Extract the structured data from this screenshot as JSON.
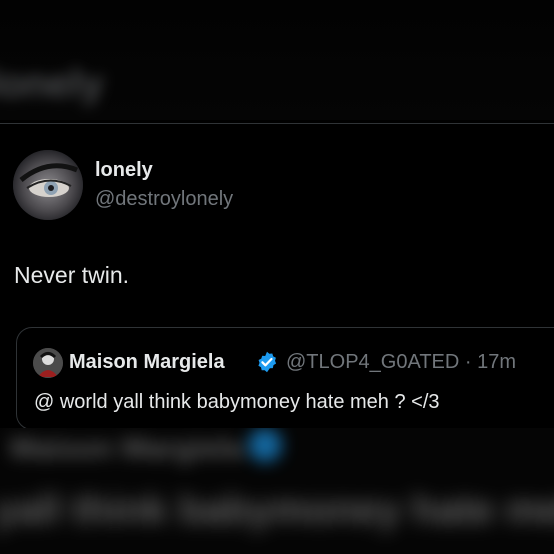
{
  "background": {
    "blurred_title": "lonely",
    "blurred_bottom_line1": "Maison Margiela",
    "blurred_bottom_line2": "yall think babymoney hate meh"
  },
  "tweet": {
    "name": "lonely",
    "handle": "@destroylonely",
    "text": "Never twin."
  },
  "quote": {
    "name": "Maison Margiela",
    "handle": "@TLOP4_G0ATED",
    "separator": "·",
    "time": "17m",
    "text": "@ world yall think babymoney hate meh ? </3"
  },
  "colors": {
    "background": "#000000",
    "text": "#e7e9ea",
    "secondary_text": "#71767b",
    "border": "#2f3336",
    "verified_badge": "#1d9bf0"
  },
  "icons": {
    "verified": "verified-badge-icon",
    "avatar": "profile-avatar",
    "quote_avatar": "quoted-user-avatar"
  }
}
